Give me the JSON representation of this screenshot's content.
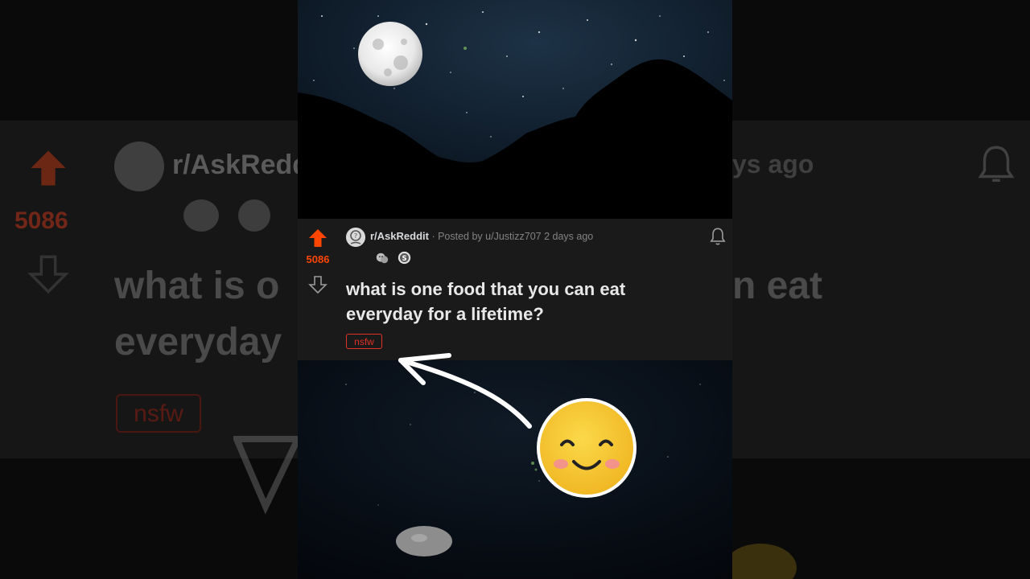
{
  "post": {
    "votes": "5086",
    "subreddit": "r/AskReddit",
    "separator": " · ",
    "posted_by": "Posted by u/Justizz707 2 days ago",
    "title": "what is one food that you can eat everyday for a lifetime?",
    "flair": "nsfw"
  },
  "background": {
    "votes": "5086",
    "subreddit": "r/AskRedd",
    "time_fragment": "ys ago",
    "title_line1": "what is o",
    "title_line2": "everyday",
    "title_right": "n eat",
    "flair": "nsfw"
  },
  "icons": {
    "upvote": "upvote-arrow-icon",
    "downvote": "downvote-arrow-icon",
    "bell": "bell-icon",
    "award_1": "wholesome-award-icon",
    "award_2": "silver-coin-award-icon",
    "emoji": "smiling-face-emoji-icon",
    "arrow": "curved-pointer-arrow-icon"
  },
  "colors": {
    "upvote": "#ff4500",
    "card": "#1a1a1b",
    "title": "#e8e8e8",
    "meta": "#818384",
    "nsfw": "#e03226",
    "emoji": "#f7cc2f"
  }
}
